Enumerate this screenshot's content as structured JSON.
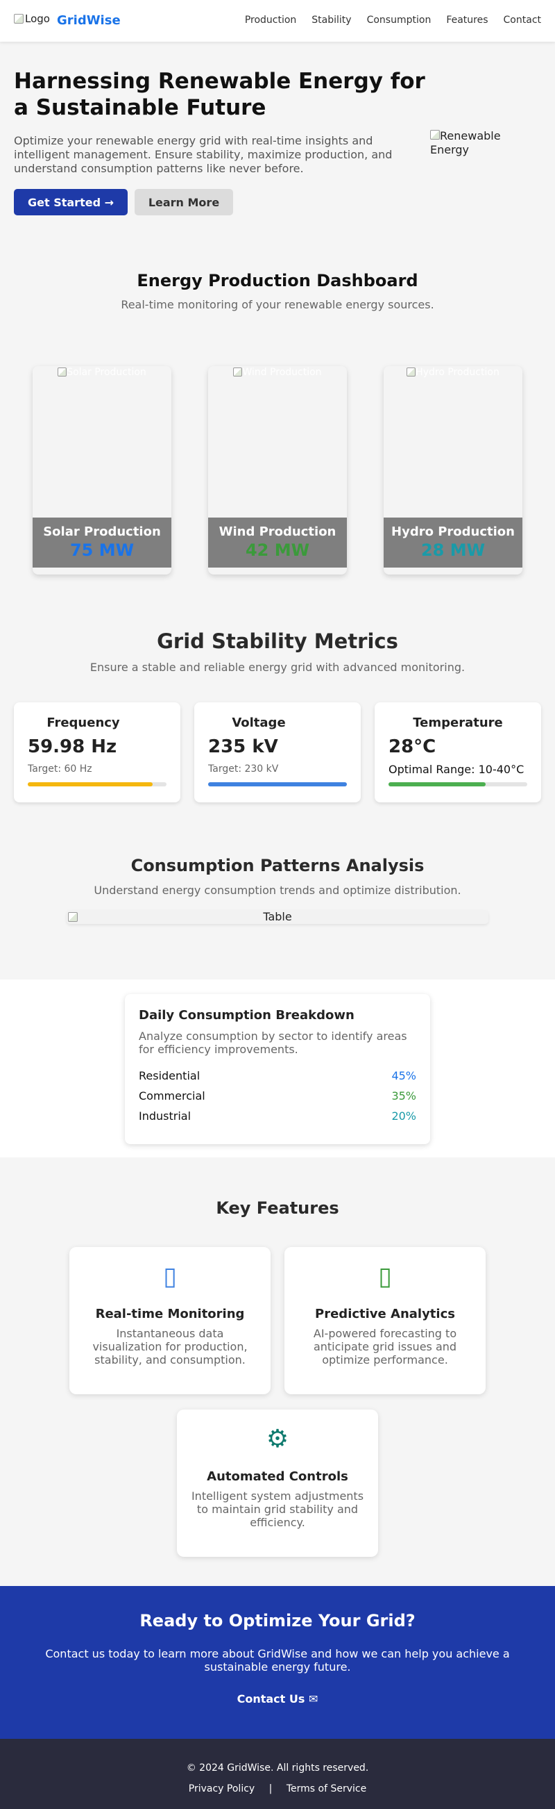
{
  "nav": {
    "logo_alt": "Logo",
    "brand": "GridWise",
    "links": [
      "Production",
      "Stability",
      "Consumption",
      "Features",
      "Contact"
    ]
  },
  "hero": {
    "title": "Harnessing Renewable Energy for a Sustainable Future",
    "text": "Optimize your renewable energy grid with real-time insights and intelligent management. Ensure stability, maximize production, and understand consumption patterns like never before.",
    "primary_button": "Get Started →",
    "secondary_button": "Learn More",
    "image_alt": "Renewable Energy"
  },
  "production": {
    "title": "Energy Production Dashboard",
    "subtitle": "Real-time monitoring of your renewable energy sources.",
    "cards": [
      {
        "image_alt": "Solar Production",
        "name": "Solar Production",
        "value": "75 MW",
        "color": "#1a73e8"
      },
      {
        "image_alt": "Wind Production",
        "name": "Wind Production",
        "value": "42 MW",
        "color": "#3b9a3b"
      },
      {
        "image_alt": "Hydro Production",
        "name": "Hydro Production",
        "value": "28 MW",
        "color": "#1a9aa8"
      }
    ]
  },
  "stability": {
    "title": "Grid Stability Metrics",
    "subtitle": "Ensure a stable and reliable energy grid with advanced monitoring.",
    "cards": [
      {
        "label": "Frequency",
        "value": "59.98 Hz",
        "target": "Target: 60 Hz",
        "level": 0.9,
        "color": "#f5b70f"
      },
      {
        "label": "Voltage",
        "value": "235 kV",
        "target": "Target: 230 kV",
        "level": 1.0,
        "color": "#3f82e0"
      },
      {
        "label": "Temperature",
        "value": "28°C",
        "target": "Optimal Range: 10-40°C",
        "level": 0.7,
        "color": "#4caf50"
      }
    ]
  },
  "consumption": {
    "title": "Consumption Patterns Analysis",
    "subtitle": "Understand energy consumption trends and optimize distribution.",
    "table_alt": "Table",
    "breakdown": {
      "title": "Daily Consumption Breakdown",
      "text": "Analyze consumption by sector to identify areas for efficiency improvements.",
      "rows": [
        {
          "sector": "Residential",
          "percent": "45%",
          "color": "#1a73e8"
        },
        {
          "sector": "Commercial",
          "percent": "35%",
          "color": "#3b9a3b"
        },
        {
          "sector": "Industrial",
          "percent": "20%",
          "color": "#1a9aa8"
        }
      ]
    }
  },
  "features": {
    "title": "Key Features",
    "items": [
      {
        "icon": "monitor-icon",
        "glyph": "▯",
        "icon_color": "#3f82e0",
        "title": "Real-time Monitoring",
        "text": "Instantaneous data visualization for production, stability, and consumption."
      },
      {
        "icon": "analytics-icon",
        "glyph": "▯",
        "icon_color": "#3b9a3b",
        "title": "Predictive Analytics",
        "text": "AI-powered forecasting to anticipate grid issues and optimize performance."
      },
      {
        "icon": "gear-icon",
        "glyph": "⚙",
        "icon_color": "#0f7a6e",
        "title": "Automated Controls",
        "text": "Intelligent system adjustments to maintain grid stability and efficiency."
      }
    ]
  },
  "cta": {
    "title": "Ready to Optimize Your Grid?",
    "text": "Contact us today to learn more about GridWise and how we can help you achieve a sustainable energy future.",
    "link": "Contact Us ✉"
  },
  "footer": {
    "copyright": "© 2024 GridWise. All rights reserved.",
    "privacy": "Privacy Policy",
    "separator": "|",
    "terms": "Terms of Service"
  }
}
